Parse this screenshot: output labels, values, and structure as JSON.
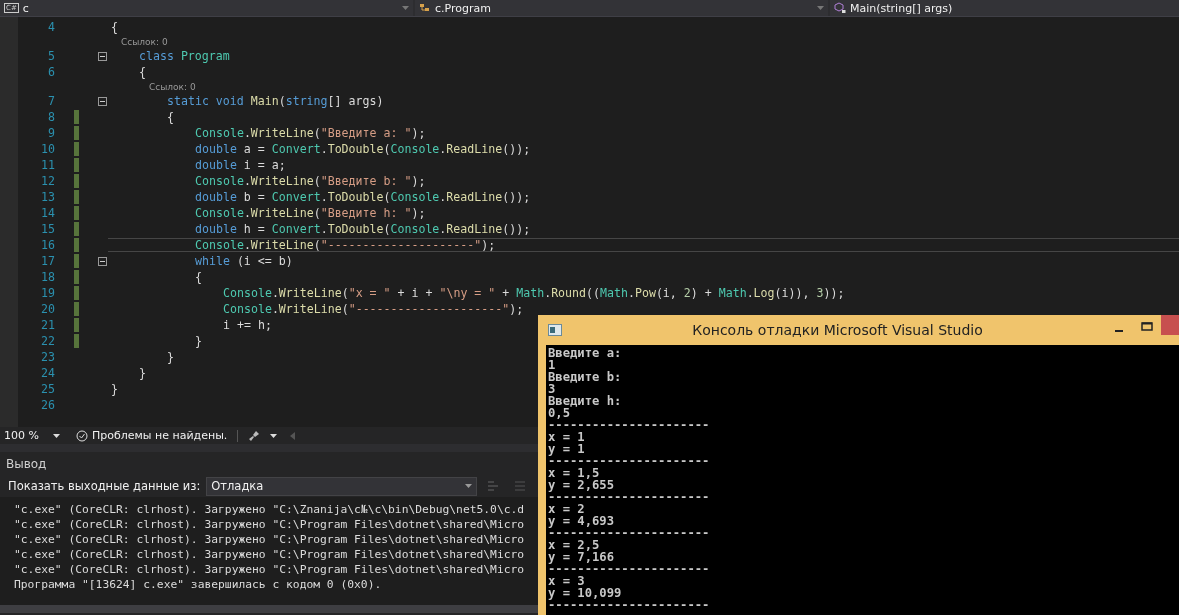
{
  "nav_bar": [
    {
      "kind": "project",
      "label": "c",
      "icon_text": "C#"
    },
    {
      "kind": "class",
      "label": "c.Program"
    },
    {
      "kind": "method",
      "label": "Main(string[] args)"
    }
  ],
  "editor": {
    "lines": [
      {
        "kind": "code",
        "number": "4",
        "fold": false,
        "changed": false,
        "current": false,
        "tokens": [
          {
            "kind": "plain",
            "text": "{"
          }
        ],
        "children": [
          {
            "kind": "lens",
            "text": "Ссылок: 0"
          },
          {
            "kind": "code",
            "number": "5",
            "fold": true,
            "changed": false,
            "current": false,
            "tokens": [
              {
                "kind": "kw",
                "text": "class "
              },
              {
                "kind": "type",
                "text": "Program"
              }
            ]
          },
          {
            "kind": "code",
            "number": "6",
            "fold": false,
            "changed": false,
            "current": false,
            "tokens": [
              {
                "kind": "plain",
                "text": "{"
              }
            ],
            "children": [
              {
                "kind": "lens",
                "text": "Ссылок: 0"
              },
              {
                "kind": "code",
                "number": "7",
                "fold": true,
                "changed": false,
                "current": false,
                "tokens": [
                  {
                    "kind": "kw",
                    "text": "static void "
                  },
                  {
                    "kind": "method",
                    "text": "Main"
                  },
                  {
                    "kind": "plain",
                    "text": "("
                  },
                  {
                    "kind": "kw",
                    "text": "string"
                  },
                  {
                    "kind": "plain",
                    "text": "[] args)"
                  }
                ]
              },
              {
                "kind": "code",
                "number": "8",
                "fold": false,
                "changed": true,
                "current": false,
                "tokens": [
                  {
                    "kind": "plain",
                    "text": "{"
                  }
                ],
                "children": [
                  {
                    "kind": "code",
                    "number": "9",
                    "fold": false,
                    "changed": true,
                    "current": false,
                    "tokens": [
                      {
                        "kind": "type",
                        "text": "Console"
                      },
                      {
                        "kind": "plain",
                        "text": "."
                      },
                      {
                        "kind": "method",
                        "text": "WriteLine"
                      },
                      {
                        "kind": "plain",
                        "text": "("
                      },
                      {
                        "kind": "str",
                        "text": "\"Введите a: \""
                      },
                      {
                        "kind": "plain",
                        "text": ");"
                      }
                    ]
                  },
                  {
                    "kind": "code",
                    "number": "10",
                    "fold": false,
                    "changed": true,
                    "current": false,
                    "tokens": [
                      {
                        "kind": "kw",
                        "text": "double"
                      },
                      {
                        "kind": "plain",
                        "text": " a = "
                      },
                      {
                        "kind": "type",
                        "text": "Convert"
                      },
                      {
                        "kind": "plain",
                        "text": "."
                      },
                      {
                        "kind": "method",
                        "text": "ToDouble"
                      },
                      {
                        "kind": "plain",
                        "text": "("
                      },
                      {
                        "kind": "type",
                        "text": "Console"
                      },
                      {
                        "kind": "plain",
                        "text": "."
                      },
                      {
                        "kind": "method",
                        "text": "ReadLine"
                      },
                      {
                        "kind": "plain",
                        "text": "());"
                      }
                    ]
                  },
                  {
                    "kind": "code",
                    "number": "11",
                    "fold": false,
                    "changed": true,
                    "current": false,
                    "tokens": [
                      {
                        "kind": "kw",
                        "text": "double"
                      },
                      {
                        "kind": "plain",
                        "text": " i = a;"
                      }
                    ]
                  },
                  {
                    "kind": "code",
                    "number": "12",
                    "fold": false,
                    "changed": true,
                    "current": false,
                    "tokens": [
                      {
                        "kind": "type",
                        "text": "Console"
                      },
                      {
                        "kind": "plain",
                        "text": "."
                      },
                      {
                        "kind": "method",
                        "text": "WriteLine"
                      },
                      {
                        "kind": "plain",
                        "text": "("
                      },
                      {
                        "kind": "str",
                        "text": "\"Введите b: \""
                      },
                      {
                        "kind": "plain",
                        "text": ");"
                      }
                    ]
                  },
                  {
                    "kind": "code",
                    "number": "13",
                    "fold": false,
                    "changed": true,
                    "current": false,
                    "tokens": [
                      {
                        "kind": "kw",
                        "text": "double"
                      },
                      {
                        "kind": "plain",
                        "text": " b = "
                      },
                      {
                        "kind": "type",
                        "text": "Convert"
                      },
                      {
                        "kind": "plain",
                        "text": "."
                      },
                      {
                        "kind": "method",
                        "text": "ToDouble"
                      },
                      {
                        "kind": "plain",
                        "text": "("
                      },
                      {
                        "kind": "type",
                        "text": "Console"
                      },
                      {
                        "kind": "plain",
                        "text": "."
                      },
                      {
                        "kind": "method",
                        "text": "ReadLine"
                      },
                      {
                        "kind": "plain",
                        "text": "());"
                      }
                    ]
                  },
                  {
                    "kind": "code",
                    "number": "14",
                    "fold": false,
                    "changed": true,
                    "current": false,
                    "tokens": [
                      {
                        "kind": "type",
                        "text": "Console"
                      },
                      {
                        "kind": "plain",
                        "text": "."
                      },
                      {
                        "kind": "method",
                        "text": "WriteLine"
                      },
                      {
                        "kind": "plain",
                        "text": "("
                      },
                      {
                        "kind": "str",
                        "text": "\"Введите h: \""
                      },
                      {
                        "kind": "plain",
                        "text": ");"
                      }
                    ]
                  },
                  {
                    "kind": "code",
                    "number": "15",
                    "fold": false,
                    "changed": true,
                    "current": false,
                    "tokens": [
                      {
                        "kind": "kw",
                        "text": "double"
                      },
                      {
                        "kind": "plain",
                        "text": " h = "
                      },
                      {
                        "kind": "type",
                        "text": "Convert"
                      },
                      {
                        "kind": "plain",
                        "text": "."
                      },
                      {
                        "kind": "method",
                        "text": "ToDouble"
                      },
                      {
                        "kind": "plain",
                        "text": "("
                      },
                      {
                        "kind": "type",
                        "text": "Console"
                      },
                      {
                        "kind": "plain",
                        "text": "."
                      },
                      {
                        "kind": "method",
                        "text": "ReadLine"
                      },
                      {
                        "kind": "plain",
                        "text": "());"
                      }
                    ]
                  },
                  {
                    "kind": "code",
                    "number": "16",
                    "fold": false,
                    "changed": true,
                    "current": true,
                    "tokens": [
                      {
                        "kind": "type",
                        "text": "Console"
                      },
                      {
                        "kind": "plain",
                        "text": "."
                      },
                      {
                        "kind": "method",
                        "text": "WriteLine"
                      },
                      {
                        "kind": "plain",
                        "text": "("
                      },
                      {
                        "kind": "str",
                        "text": "\"---------------------\""
                      },
                      {
                        "kind": "plain",
                        "text": ");"
                      }
                    ]
                  },
                  {
                    "kind": "code",
                    "number": "17",
                    "fold": true,
                    "changed": true,
                    "current": false,
                    "tokens": [
                      {
                        "kind": "kw",
                        "text": "while"
                      },
                      {
                        "kind": "plain",
                        "text": " (i <= b)"
                      }
                    ]
                  },
                  {
                    "kind": "code",
                    "number": "18",
                    "fold": false,
                    "changed": true,
                    "current": false,
                    "tokens": [
                      {
                        "kind": "plain",
                        "text": "{"
                      }
                    ],
                    "children": [
                      {
                        "kind": "code",
                        "number": "19",
                        "fold": false,
                        "changed": true,
                        "current": false,
                        "tokens": [
                          {
                            "kind": "type",
                            "text": "Console"
                          },
                          {
                            "kind": "plain",
                            "text": "."
                          },
                          {
                            "kind": "method",
                            "text": "WriteLine"
                          },
                          {
                            "kind": "plain",
                            "text": "("
                          },
                          {
                            "kind": "str",
                            "text": "\"x = \""
                          },
                          {
                            "kind": "plain",
                            "text": " + i + "
                          },
                          {
                            "kind": "str",
                            "text": "\"\\ny = \""
                          },
                          {
                            "kind": "plain",
                            "text": " + "
                          },
                          {
                            "kind": "type",
                            "text": "Math"
                          },
                          {
                            "kind": "plain",
                            "text": "."
                          },
                          {
                            "kind": "method",
                            "text": "Round"
                          },
                          {
                            "kind": "plain",
                            "text": "(("
                          },
                          {
                            "kind": "type",
                            "text": "Math"
                          },
                          {
                            "kind": "plain",
                            "text": "."
                          },
                          {
                            "kind": "method",
                            "text": "Pow"
                          },
                          {
                            "kind": "plain",
                            "text": "(i, "
                          },
                          {
                            "kind": "num",
                            "text": "2"
                          },
                          {
                            "kind": "plain",
                            "text": ") + "
                          },
                          {
                            "kind": "type",
                            "text": "Math"
                          },
                          {
                            "kind": "plain",
                            "text": "."
                          },
                          {
                            "kind": "method",
                            "text": "Log"
                          },
                          {
                            "kind": "plain",
                            "text": "(i)), "
                          },
                          {
                            "kind": "num",
                            "text": "3"
                          },
                          {
                            "kind": "plain",
                            "text": "));"
                          }
                        ]
                      },
                      {
                        "kind": "code",
                        "number": "20",
                        "fold": false,
                        "changed": true,
                        "current": false,
                        "tokens": [
                          {
                            "kind": "type",
                            "text": "Console"
                          },
                          {
                            "kind": "plain",
                            "text": "."
                          },
                          {
                            "kind": "method",
                            "text": "WriteLine"
                          },
                          {
                            "kind": "plain",
                            "text": "("
                          },
                          {
                            "kind": "str",
                            "text": "\"---------------------\""
                          },
                          {
                            "kind": "plain",
                            "text": ");"
                          }
                        ]
                      },
                      {
                        "kind": "code",
                        "number": "21",
                        "fold": false,
                        "changed": true,
                        "current": false,
                        "tokens": [
                          {
                            "kind": "plain",
                            "text": "i += h;"
                          }
                        ]
                      }
                    ]
                  },
                  {
                    "kind": "code",
                    "number": "22",
                    "fold": false,
                    "changed": true,
                    "current": false,
                    "tokens": [
                      {
                        "kind": "plain",
                        "text": "}"
                      }
                    ]
                  }
                ]
              },
              {
                "kind": "code",
                "number": "23",
                "fold": false,
                "changed": false,
                "current": false,
                "tokens": [
                  {
                    "kind": "plain",
                    "text": "}"
                  }
                ]
              }
            ]
          },
          {
            "kind": "code",
            "number": "24",
            "fold": false,
            "changed": false,
            "current": false,
            "tokens": [
              {
                "kind": "plain",
                "text": "}"
              }
            ]
          }
        ]
      },
      {
        "kind": "code",
        "number": "25",
        "fold": false,
        "changed": false,
        "current": false,
        "tokens": [
          {
            "kind": "plain",
            "text": "}"
          }
        ]
      },
      {
        "kind": "code",
        "number": "26",
        "fold": false,
        "changed": false,
        "current": false
      }
    ]
  },
  "status_bar": {
    "zoom": "100 %",
    "problems": "Проблемы не найдены."
  },
  "output": {
    "title": "Вывод",
    "source_label": "Показать выходные данные из:",
    "source_value": "Отладка",
    "lines": [
      "\"c.exe\" (CoreCLR: clrhost). Загружено \"C:\\Znanija\\c№\\c\\bin\\Debug\\net5.0\\c.d",
      "\"c.exe\" (CoreCLR: clrhost). Загружено \"C:\\Program Files\\dotnet\\shared\\Micro",
      "\"c.exe\" (CoreCLR: clrhost). Загружено \"C:\\Program Files\\dotnet\\shared\\Micro",
      "\"c.exe\" (CoreCLR: clrhost). Загружено \"C:\\Program Files\\dotnet\\shared\\Micro",
      "\"c.exe\" (CoreCLR: clrhost). Загружено \"C:\\Program Files\\dotnet\\shared\\Micro",
      "Программа \"[13624] c.exe\" завершилась с кодом 0 (0x0)."
    ]
  },
  "console": {
    "title": "Консоль отладки Microsoft Visual Studio",
    "lines": [
      "Введите a:",
      "1",
      "Введите b:",
      "3",
      "Введите h:",
      "0,5",
      "----------------------",
      "x = 1",
      "y = 1",
      "----------------------",
      "x = 1,5",
      "y = 2,655",
      "----------------------",
      "x = 2",
      "y = 4,693",
      "----------------------",
      "x = 2,5",
      "y = 7,166",
      "----------------------",
      "x = 3",
      "y = 10,099",
      "----------------------"
    ]
  }
}
